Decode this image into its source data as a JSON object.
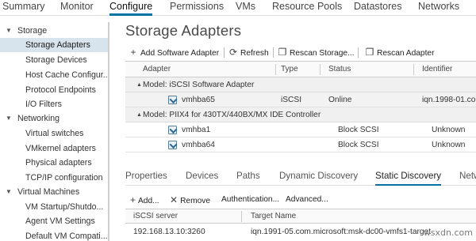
{
  "top_tabs": [
    "Summary",
    "Monitor",
    "Configure",
    "Permissions",
    "VMs",
    "Resource Pools",
    "Datastores",
    "Networks"
  ],
  "active_top_tab": "Configure",
  "sidebar": {
    "storage": {
      "label": "Storage",
      "items": [
        "Storage Adapters",
        "Storage Devices",
        "Host Cache Configur...",
        "Protocol Endpoints",
        "I/O Filters"
      ]
    },
    "networking": {
      "label": "Networking",
      "items": [
        "Virtual switches",
        "VMkernel adapters",
        "Physical adapters",
        "TCP/IP configuration"
      ]
    },
    "vms": {
      "label": "Virtual Machines",
      "items": [
        "VM Startup/Shutdo...",
        "Agent VM Settings",
        "Default VM Compati..."
      ]
    },
    "selected": "Storage Adapters"
  },
  "main": {
    "title": "Storage Adapters",
    "toolbar": {
      "add_software_adapter": "Add Software Adapter",
      "refresh": "Refresh",
      "rescan_storage": "Rescan Storage...",
      "rescan_adapter": "Rescan Adapter"
    },
    "columns": [
      "Adapter",
      "Type",
      "Status",
      "Identifier"
    ],
    "groups": [
      {
        "label": "Model: iSCSI Software Adapter",
        "rows": [
          {
            "adapter": "vmhba65",
            "type": "iSCSI",
            "status": "Online",
            "identifier": "iqn.1998-01.com"
          }
        ]
      },
      {
        "label": "Model: PIIX4 for 430TX/440BX/MX IDE Controller",
        "rows": [
          {
            "adapter": "vmhba1",
            "type": "Block SCSI",
            "status": "Unknown",
            "identifier": ""
          },
          {
            "adapter": "vmhba64",
            "type": "Block SCSI",
            "status": "Unknown",
            "identifier": ""
          }
        ]
      }
    ]
  },
  "detail_tabs": [
    "Properties",
    "Devices",
    "Paths",
    "Dynamic Discovery",
    "Static Discovery",
    "Netw"
  ],
  "active_detail_tab": "Static Discovery",
  "detail_toolbar": {
    "add": "Add...",
    "remove": "Remove",
    "authentication": "Authentication...",
    "advanced": "Advanced..."
  },
  "static_discovery": {
    "columns": [
      "iSCSI server",
      "Target Name"
    ],
    "rows": [
      {
        "server": "192.168.13.10:3260",
        "target": "iqn.1991-05.com.microsoft:msk-dc00-vmfs1-target"
      }
    ]
  },
  "watermark": "wsxdn.com",
  "colors": {
    "accent": "#0072a3",
    "selection": "#d8e4ed"
  }
}
